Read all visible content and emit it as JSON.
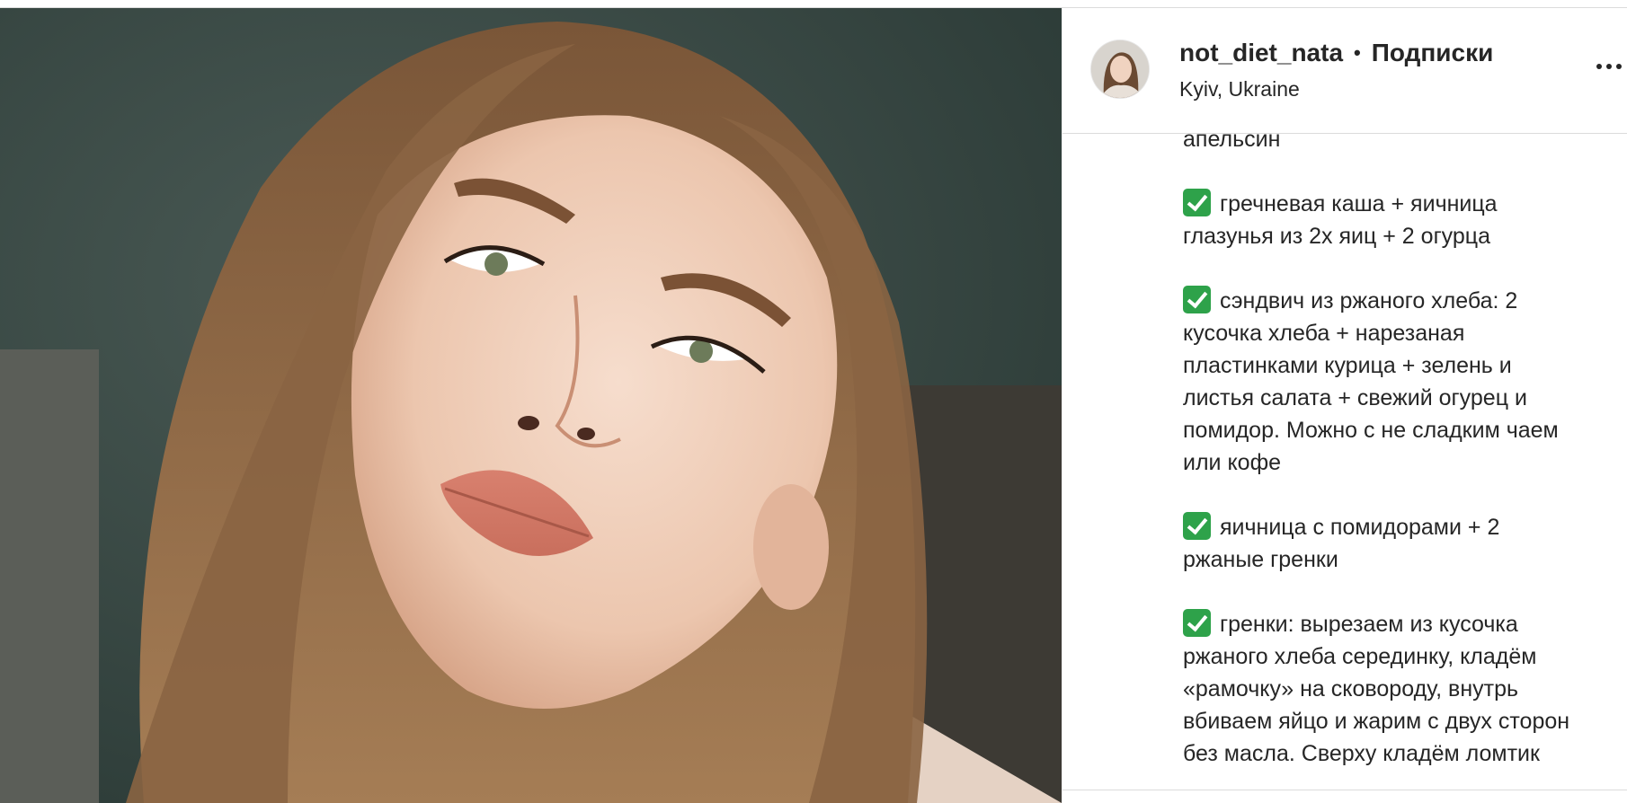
{
  "post": {
    "username": "not_diet_nata",
    "separator": "•",
    "follow_label": "Подписки",
    "location": "Kyiv, Ukraine"
  },
  "caption": {
    "lines": [
      "апельсин",
      "гречневая каша + яичница",
      "глазунья из 2х яиц + 2 огурца",
      "сэндвич из ржаного хлеба: 2",
      "кусочка хлеба + нарезаная",
      "пластинками курица + зелень и",
      "листья салата + свежий огурец и",
      "помидор. Можно с не сладким чаем",
      "или кофе",
      "яичница с помидорами + 2",
      "ржаные гренки",
      "гренки: вырезаем из кусочка",
      "ржаного хлеба серединку, кладём",
      "«рамочку» на сковороду, внутрь",
      "вбиваем яйцо и жарим с двух сторон",
      "без масла. Сверху кладём ломтик"
    ]
  },
  "icons": {
    "check": "check-mark-button-icon",
    "more": "more-options-icon",
    "check_color": "#2ea24a"
  }
}
